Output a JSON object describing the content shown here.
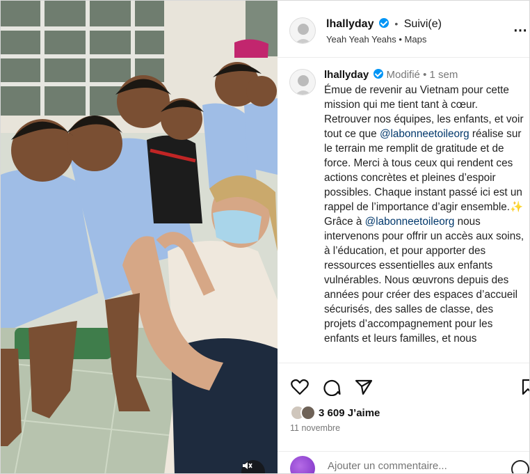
{
  "post": {
    "username": "lhallyday",
    "follow_status": "Suivi(e)",
    "audio": "Yeah Yeah Yeahs • Maps",
    "caption_username": "lhallyday",
    "edited_label": "Modifié",
    "caption_age": "1 sem",
    "caption_parts": [
      "Émue de revenir au Vietnam pour cette mission qui me tient tant à cœur. Retrouver nos équipes, les enfants, et voir tout ce que ",
      "@labonneetoileorg",
      " réalise sur le terrain me remplit de gratitude et de force. Merci à tous ceux qui rendent ces actions concrètes et pleines d’espoir possibles. Chaque instant passé ici est un rappel de l’importance d’agir ensemble.",
      "✨",
      " Grâce à ",
      "@labonneetoileorg",
      " nous intervenons pour offrir un accès aux soins, à l’éducation, et pour apporter des ressources essentielles aux enfants vulnérables. Nous œuvrons depuis des années pour créer des espaces d’accueil sécurisés, des salles de classe, des projets d’accompagnement pour les enfants et leurs familles, et nous"
    ],
    "likes": "3 609 J’aime",
    "date": "11 novembre",
    "comment_placeholder": "Ajouter un commentaire..."
  },
  "icons": {
    "like": "heart-icon",
    "comment": "comment-icon",
    "share": "share-icon",
    "save": "bookmark-icon",
    "more": "more-icon",
    "mute": "mute-icon",
    "emoji": "emoji-icon",
    "verified": "verified-badge-icon"
  },
  "colors": {
    "verified": "#0095f6",
    "mention": "#00376b",
    "meta": "#777777"
  }
}
